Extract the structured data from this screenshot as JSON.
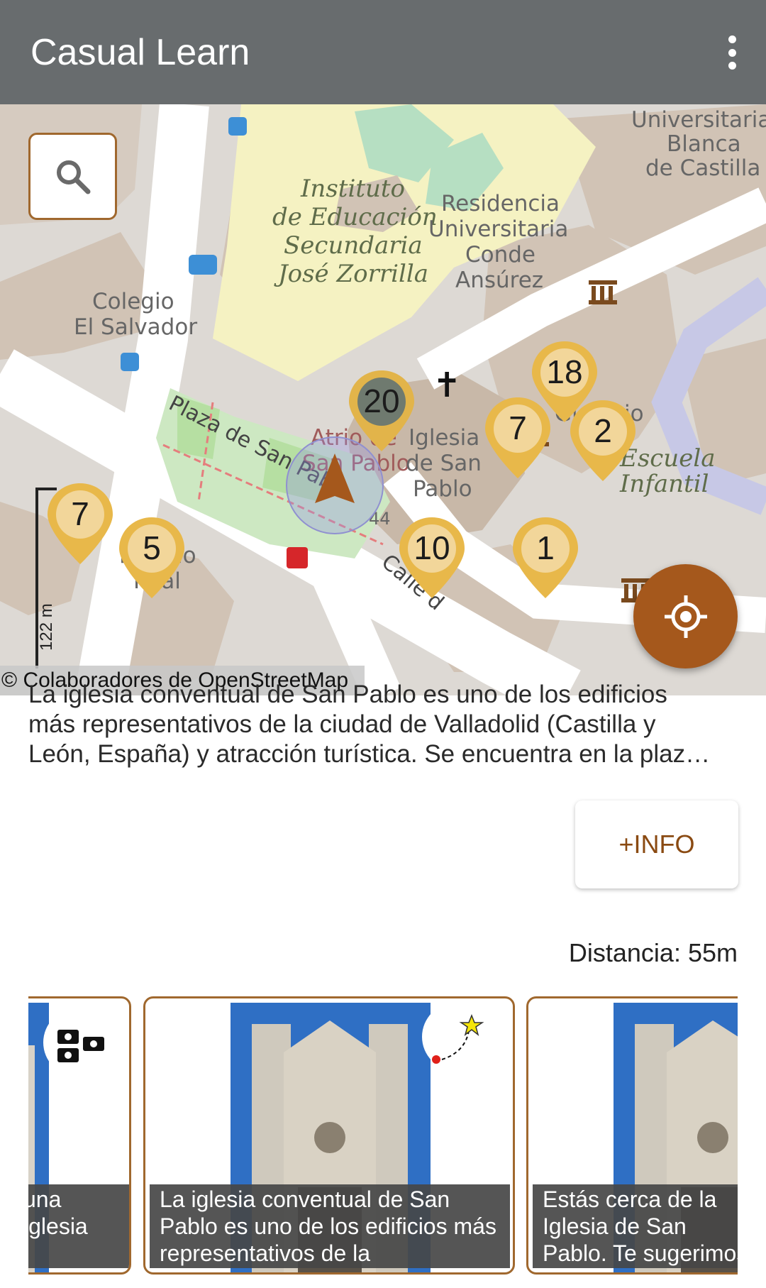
{
  "app": {
    "title": "Casual Learn"
  },
  "map": {
    "attribution": "© Colaboradores de OpenStreetMap",
    "scale_label": "122 m",
    "labels": {
      "instituto": [
        "Instituto",
        "de Educación",
        "Secundaria",
        "José Zorrilla"
      ],
      "residencia": [
        "Residencia",
        "Universitaria",
        "Conde",
        "Ansúrez"
      ],
      "universitaria": [
        "Universitaria",
        "Blanca",
        "de Castilla"
      ],
      "colegio": [
        "Colegio",
        "El Salvador"
      ],
      "plaza": "Plaza de San Pablo",
      "atrio": [
        "Atrio de",
        "San Pablo"
      ],
      "iglesia": [
        "Iglesia",
        "de San",
        "Pablo"
      ],
      "escuela": [
        "Escuela",
        "Infantil"
      ],
      "palacio": [
        "Palacio",
        "Real"
      ],
      "calle": "Calle d",
      "giro": "Gi",
      "giro_end": "io",
      "number": "44"
    },
    "markers": [
      "20",
      "18",
      "7",
      "2",
      "7",
      "5",
      "10",
      "1"
    ]
  },
  "description": {
    "line1": "La iglesia conventual de San Pablo es uno de los edificios",
    "line2": "más representativos de la ciudad de Valladolid (Castilla y",
    "line3": "León, España) y atracción turística. Se encuentra en la plaz…"
  },
  "info_button": "+INFO",
  "distance": "Distancia: 55m",
  "cards": [
    {
      "caption": "una\niglesia"
    },
    {
      "caption": "La iglesia conventual de San Pablo es uno de los edificios más representativos de la"
    },
    {
      "caption": "Estás cerca de la Iglesia de San Pablo. Te sugerimos visitar la Iglesia de San Pablo"
    }
  ],
  "colors": {
    "accent": "#a0682e",
    "appbar": "#686c6e",
    "marker": "#e8b84a",
    "locate": "#a5581c"
  }
}
